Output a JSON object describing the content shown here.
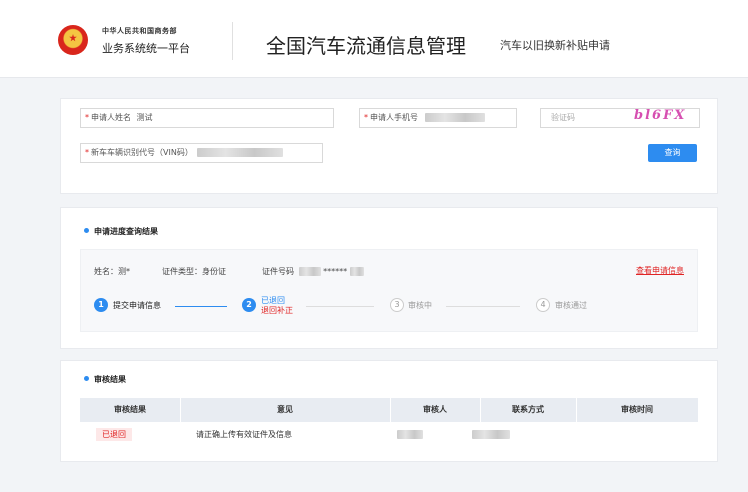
{
  "header": {
    "org_small": "中华人民共和国商务部",
    "org_big": "业务系统统一平台",
    "title": "全国汽车流通信息管理",
    "subtitle": "汽车以旧换新补贴申请"
  },
  "search": {
    "name_label": "申请人姓名",
    "name_value": "测试",
    "phone_label": "申请人手机号",
    "captcha_placeholder": "验证码",
    "captcha_text": "bl6FX",
    "vin_label": "新车车辆识别代号（VIN码）",
    "query_button": "查询"
  },
  "progress": {
    "section_title": "申请进度查询结果",
    "name_info": "姓名：测*",
    "id_type_info": "证件类型：身份证",
    "id_no_label": "证件号码",
    "id_no_mask": "******",
    "view_link": "查看申请信息",
    "steps": [
      {
        "num": "1",
        "label": "提交申请信息",
        "sub": ""
      },
      {
        "num": "2",
        "label": "已退回",
        "sub": "退回补正"
      },
      {
        "num": "3",
        "label": "审核中",
        "sub": ""
      },
      {
        "num": "4",
        "label": "审核通过",
        "sub": ""
      }
    ]
  },
  "review": {
    "section_title": "审核结果",
    "columns": [
      "审核结果",
      "意见",
      "审核人",
      "联系方式",
      "审核时间"
    ],
    "row": {
      "status": "已退回",
      "opinion": "请正确上传有效证件及信息"
    }
  },
  "colors": {
    "accent": "#2d8cf0",
    "danger": "#e02424"
  }
}
